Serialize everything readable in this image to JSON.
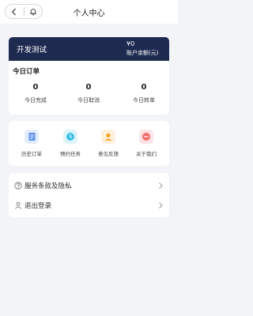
{
  "header": {
    "title": "个人中心"
  },
  "account": {
    "name": "开发测试",
    "balance": "¥0",
    "balance_label": "账户余额(元)"
  },
  "orders": {
    "title": "今日订单",
    "stats": [
      {
        "value": "0",
        "label": "今日完成"
      },
      {
        "value": "0",
        "label": "今日取消"
      },
      {
        "value": "0",
        "label": "今日转单"
      }
    ]
  },
  "shortcuts": [
    {
      "label": "历史订单",
      "icon": "document-icon",
      "color": "#5b8ff0",
      "bg": "#e4edfc"
    },
    {
      "label": "预约任务",
      "icon": "clock-icon",
      "color": "#3cbfe6",
      "bg": "#def4fb"
    },
    {
      "label": "意见反馈",
      "icon": "feedback-icon",
      "color": "#f5a623",
      "bg": "#fdf0dc"
    },
    {
      "label": "关于我们",
      "icon": "info-icon",
      "color": "#f06c6c",
      "bg": "#fde4e4"
    }
  ],
  "menu": [
    {
      "label": "服务条款及隐私",
      "icon": "help-circle-icon"
    },
    {
      "label": "退出登录",
      "icon": "user-icon"
    }
  ]
}
